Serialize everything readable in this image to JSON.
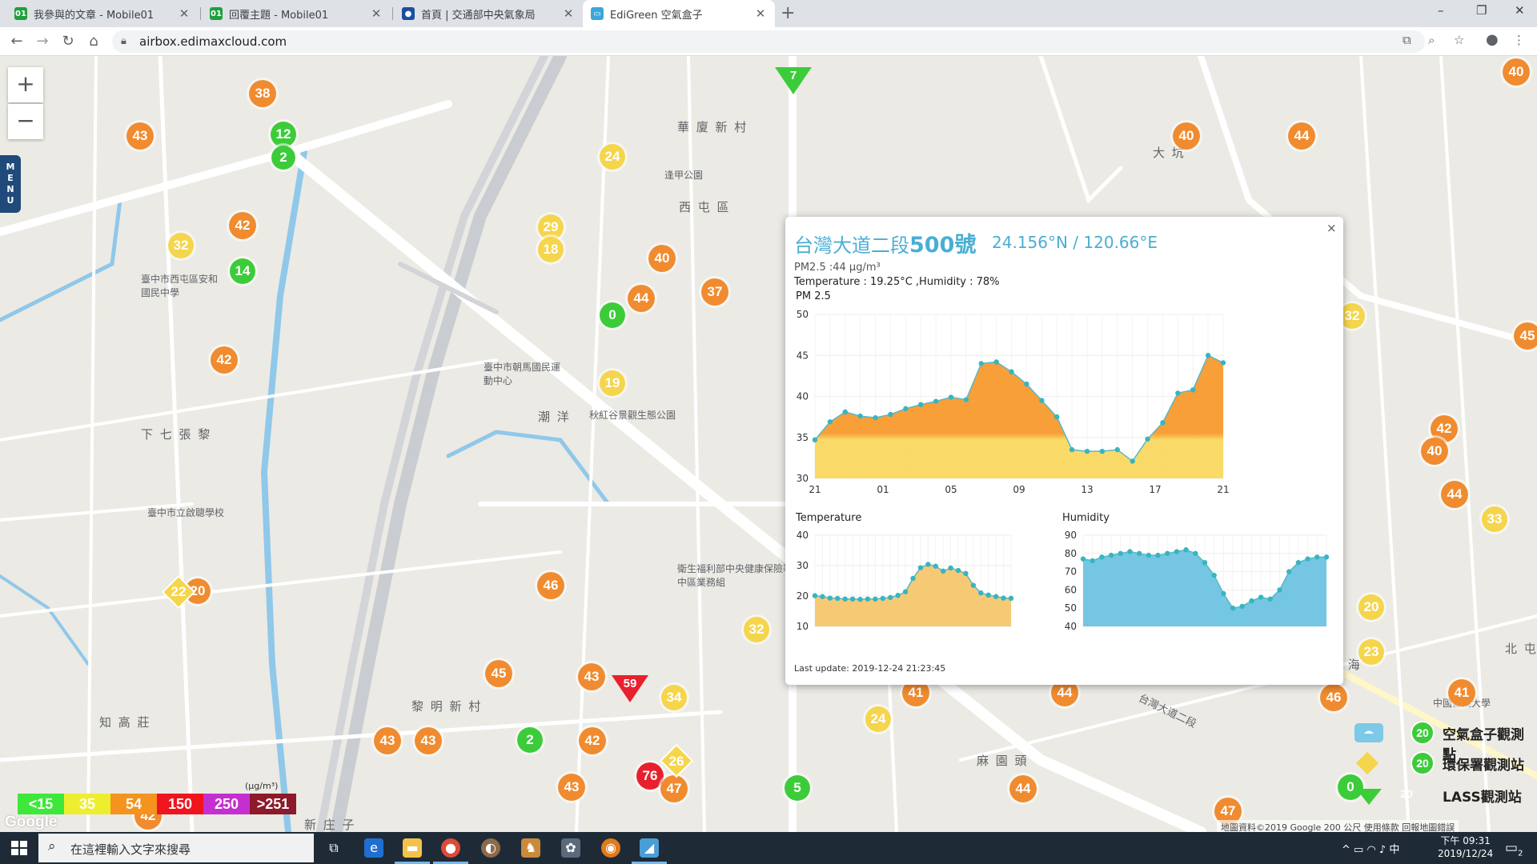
{
  "browser": {
    "tabs": [
      {
        "label": "我參與的文章 - Mobile01",
        "favicon": "mobile01-icon",
        "color": "#1ea03c",
        "active": false
      },
      {
        "label": "回覆主題 - Mobile01",
        "favicon": "mobile01-icon",
        "color": "#1ea03c",
        "active": false
      },
      {
        "label": "首頁 | 交通部中央氣象局",
        "favicon": "cwb-icon",
        "color": "#1a4fa0",
        "active": false
      },
      {
        "label": "EdiGreen 空氣盒子",
        "favicon": "edigreen-icon",
        "color": "#39a7d8",
        "active": true
      }
    ],
    "new_tab_glyph": "+",
    "url": "airbox.edimaxcloud.com",
    "window_controls": [
      "–",
      "❐",
      "✕"
    ]
  },
  "map": {
    "zoom_in": "+",
    "zoom_out": "−",
    "menu_label": [
      "M",
      "E",
      "N",
      "U"
    ],
    "places": [
      {
        "text": "華 廈 新 村"
      },
      {
        "text": "西 屯 區"
      },
      {
        "text": "潮 洋"
      },
      {
        "text": "下 七 張 黎"
      },
      {
        "text": "黎 明 新 村"
      },
      {
        "text": "知 高 莊"
      },
      {
        "text": "新 庄 子"
      },
      {
        "text": "麻 園 頭"
      },
      {
        "text": "中 海"
      },
      {
        "text": "北 屯"
      },
      {
        "text": "大 坑"
      },
      {
        "text": "逢甲公園"
      },
      {
        "text": "秋紅谷景觀生態公園"
      },
      {
        "text": "臺中市西屯區安和國民中學"
      },
      {
        "text": "臺中市立啟聰學校"
      },
      {
        "text": "臺中市朝馬國民運動中心"
      },
      {
        "text": "衛生福利部中央健康保險署中區業務組"
      },
      {
        "text": "中國醫藥大學"
      },
      {
        "text": "台灣大道二段"
      }
    ],
    "markers": [
      {
        "label": "38",
        "color": "#f08b2f"
      },
      {
        "label": "43",
        "color": "#f08b2f"
      },
      {
        "label": "12",
        "color": "#3ccc3a"
      },
      {
        "label": "2",
        "color": "#3ccc3a"
      },
      {
        "label": "42",
        "color": "#f08b2f"
      },
      {
        "label": "32",
        "color": "#f5d54c"
      },
      {
        "label": "14",
        "color": "#3ccc3a"
      },
      {
        "label": "42",
        "color": "#f08b2f"
      },
      {
        "label": "24",
        "color": "#f5d54c"
      },
      {
        "label": "29",
        "color": "#f5d54c"
      },
      {
        "label": "18",
        "color": "#f5d54c"
      },
      {
        "label": "40",
        "color": "#f08b2f"
      },
      {
        "label": "44",
        "color": "#f08b2f"
      },
      {
        "label": "0",
        "color": "#3ccc3a"
      },
      {
        "label": "37",
        "color": "#f08b2f"
      },
      {
        "label": "19",
        "color": "#f5d54c"
      },
      {
        "label": "40",
        "color": "#f08b2f"
      },
      {
        "label": "44",
        "color": "#f08b2f"
      },
      {
        "label": "40",
        "color": "#f08b2f"
      },
      {
        "label": "32",
        "color": "#f5d54c"
      },
      {
        "label": "42",
        "color": "#f08b2f"
      },
      {
        "label": "40",
        "color": "#f08b2f"
      },
      {
        "label": "44",
        "color": "#f08b2f"
      },
      {
        "label": "33",
        "color": "#f5d54c"
      },
      {
        "label": "20",
        "color": "#f5d54c"
      },
      {
        "label": "23",
        "color": "#f5d54c"
      },
      {
        "label": "46",
        "color": "#f08b2f"
      },
      {
        "label": "41",
        "color": "#f08b2f"
      },
      {
        "label": "45",
        "color": "#f08b2f"
      },
      {
        "label": "46",
        "color": "#f08b2f"
      },
      {
        "label": "32",
        "color": "#f5d54c"
      },
      {
        "label": "45",
        "color": "#f08b2f"
      },
      {
        "label": "43",
        "color": "#f08b2f"
      },
      {
        "label": "34",
        "color": "#f5d54c"
      },
      {
        "label": "43",
        "color": "#f08b2f"
      },
      {
        "label": "43",
        "color": "#f08b2f"
      },
      {
        "label": "2",
        "color": "#3ccc3a"
      },
      {
        "label": "42",
        "color": "#f08b2f"
      },
      {
        "label": "76",
        "color": "#e8202e"
      },
      {
        "label": "47",
        "color": "#f08b2f"
      },
      {
        "label": "43",
        "color": "#f08b2f"
      },
      {
        "label": "5",
        "color": "#3ccc3a"
      },
      {
        "label": "41",
        "color": "#f08b2f"
      },
      {
        "label": "24",
        "color": "#f5d54c"
      },
      {
        "label": "44",
        "color": "#f08b2f"
      },
      {
        "label": "44",
        "color": "#f08b2f"
      },
      {
        "label": "47",
        "color": "#f08b2f"
      },
      {
        "label": "0",
        "color": "#3ccc3a"
      },
      {
        "label": "42",
        "color": "#f08b2f"
      },
      {
        "label": "20",
        "color": "#f08b2f"
      },
      {
        "label": "45",
        "color": "#f08b2f"
      },
      {
        "label": "41",
        "color": "#f08b2f"
      }
    ],
    "diamonds": [
      {
        "label": "22"
      },
      {
        "label": "26"
      }
    ],
    "triangles": [
      {
        "label": "7",
        "color": "#3ccc3a"
      },
      {
        "label": "59",
        "color": "#e8202e"
      }
    ],
    "legend": [
      {
        "label": "<15",
        "color": "#3ee83a"
      },
      {
        "label": "35",
        "color": "#eeee30"
      },
      {
        "label": "54",
        "color": "#f4931e"
      },
      {
        "label": "150",
        "color": "#f0141e"
      },
      {
        "label": "250",
        "color": "#c430d0"
      },
      {
        "label": ">251",
        "color": "#8c1a2a"
      }
    ],
    "legend_unit": "(μg/m³)",
    "google_logo": "Google",
    "attribution": "地圖資料©2019 Google    200 公尺          使用條款    回報地圖錯誤",
    "station_legend": [
      {
        "badge": "20",
        "label": "空氣盒子觀測點",
        "icon": "airbox-station-icon"
      },
      {
        "badge": "20",
        "label": "環保署觀測站",
        "icon": "epa-station-icon"
      },
      {
        "badge": "20",
        "label": "LASS觀測站",
        "icon": "lass-station-icon"
      }
    ]
  },
  "popup": {
    "title_prefix": "台灣大道二段",
    "title_number": "500號",
    "coords": "24.156°N / 120.66°E",
    "close": "×",
    "pm25_line": "PM2.5 :44 μg/m³",
    "temp_line": "Temperature : 19.25°C ,Humidity : 78%",
    "pm_chart_title": "PM 2.5",
    "temp_chart_title": "Temperature",
    "hum_chart_title": "Humidity",
    "last_update": "Last update: 2019-12-24 21:23:45"
  },
  "chart_data": [
    {
      "type": "area",
      "title": "PM 2.5",
      "x_ticks": [
        "21",
        "01",
        "05",
        "09",
        "13",
        "17",
        "21"
      ],
      "ylim": [
        30,
        50
      ],
      "y_ticks": [
        30,
        35,
        40,
        45,
        50
      ],
      "values": [
        34.7,
        36.9,
        38.1,
        37.6,
        37.4,
        37.8,
        38.5,
        39.0,
        39.4,
        39.9,
        39.6,
        44.0,
        44.2,
        43.0,
        41.5,
        39.5,
        37.5,
        33.5,
        33.3,
        33.3,
        33.5,
        32.1,
        34.8,
        36.8,
        40.4,
        40.8,
        45.0,
        44.1
      ],
      "color_high": "#f79a2e",
      "color_low": "#f9d860",
      "point_color": "#36b5c2",
      "grid": true
    },
    {
      "type": "area",
      "title": "Temperature",
      "ylim": [
        10,
        40
      ],
      "y_ticks": [
        10,
        20,
        30,
        40
      ],
      "values": [
        20.1,
        19.8,
        19.3,
        19.2,
        19.0,
        19.0,
        18.9,
        19.0,
        19.0,
        19.2,
        19.5,
        20.2,
        21.4,
        25.8,
        29.3,
        30.4,
        29.8,
        28.2,
        29.2,
        28.4,
        27.4,
        23.5,
        21.0,
        20.3,
        19.8,
        19.3,
        19.25
      ],
      "color": "#f5c66e",
      "point_color": "#36b5c2",
      "grid": true
    },
    {
      "type": "area",
      "title": "Humidity",
      "ylim": [
        40,
        90
      ],
      "y_ticks": [
        40,
        50,
        60,
        70,
        80,
        90
      ],
      "values": [
        77,
        76,
        78,
        79,
        80,
        81,
        80,
        79,
        79,
        80,
        81,
        82,
        80,
        75,
        68,
        58,
        50,
        51,
        54,
        56,
        55,
        60,
        70,
        75,
        77,
        78,
        78
      ],
      "color": "#6ec3e0",
      "point_color": "#36b5c2",
      "grid": true
    }
  ],
  "taskbar": {
    "search_placeholder": "在這裡輸入文字來搜尋",
    "tray_text": "^  ▭  ◠  ♪  中",
    "time": "下午 09:31",
    "date": "2019/12/24",
    "notifications": "2"
  }
}
